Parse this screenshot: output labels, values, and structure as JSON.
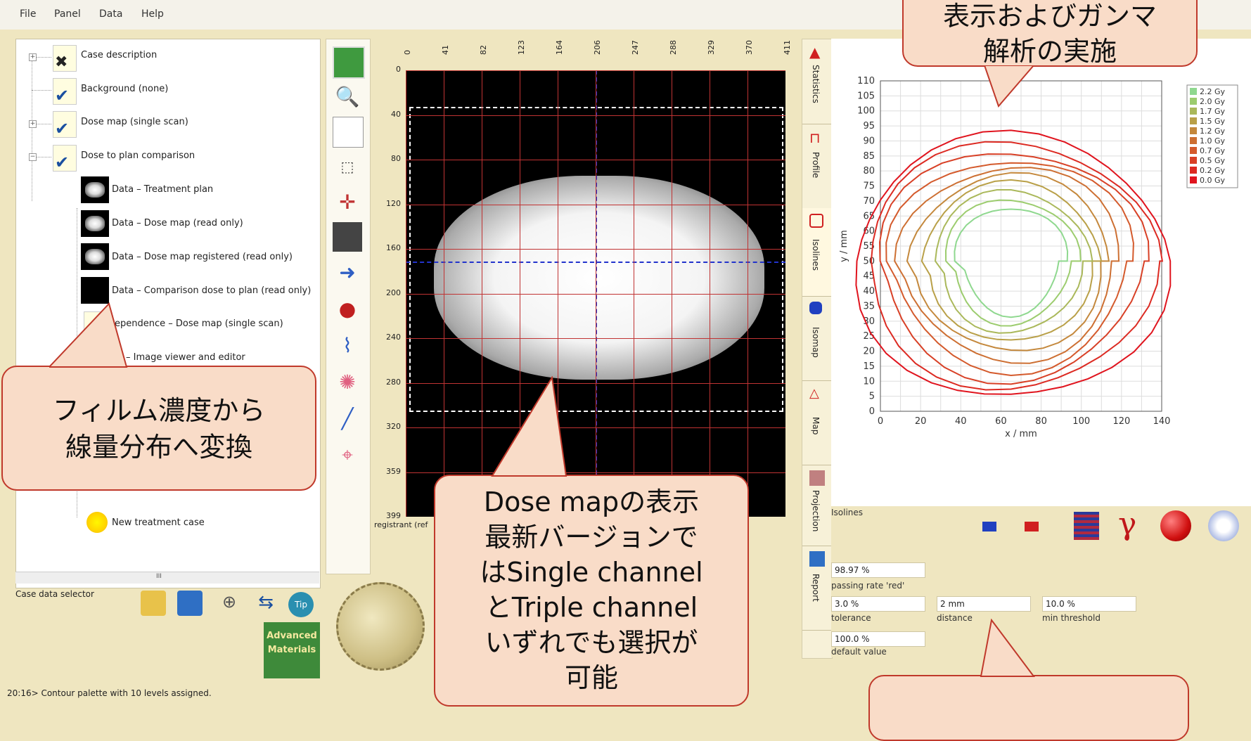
{
  "menu": [
    "File",
    "Panel",
    "Data",
    "Help"
  ],
  "tree": {
    "nodes": [
      {
        "label": "Case description"
      },
      {
        "label": "Background (none)"
      },
      {
        "label": "Dose map (single scan)"
      },
      {
        "label": "Dose to plan comparison"
      },
      {
        "label": "Data – Treatment plan"
      },
      {
        "label": "Data – Dose map (read only)"
      },
      {
        "label": "Data – Dose map registered (read only)"
      },
      {
        "label": "Data – Comparison dose to plan (read only)"
      },
      {
        "label": "ependence – Dose map (single scan)"
      },
      {
        "label": "– Image viewer and editor"
      },
      {
        "label": "New treatment case"
      }
    ],
    "selector_label": "Case data selector",
    "scroll_marker": "III"
  },
  "image": {
    "x_ticks": [
      "0",
      "41",
      "82",
      "123",
      "164",
      "206",
      "247",
      "288",
      "329",
      "370",
      "411"
    ],
    "y_ticks": [
      "0",
      "40",
      "80",
      "120",
      "160",
      "200",
      "240",
      "280",
      "320",
      "359",
      "399"
    ],
    "footer_label": "registrant (ref"
  },
  "vtabs": [
    "Statistics",
    "Profile",
    "Isolines",
    "Isomap",
    "Map",
    "Projection",
    "Report"
  ],
  "chart_data": {
    "type": "line",
    "xlabel": "x / mm",
    "ylabel": "y / mm",
    "xlim": [
      0,
      140
    ],
    "ylim": [
      0,
      110
    ],
    "x_ticks": [
      "0",
      "20",
      "40",
      "60",
      "80",
      "100",
      "120",
      "140"
    ],
    "y_ticks": [
      "110",
      "105",
      "100",
      "95",
      "90",
      "85",
      "80",
      "75",
      "70",
      "65",
      "60",
      "55",
      "50",
      "45",
      "40",
      "35",
      "30",
      "25",
      "20",
      "15",
      "10",
      "5",
      "0"
    ],
    "legend": [
      {
        "name": "2.2 Gy",
        "color": "#8fd88f"
      },
      {
        "name": "2.0 Gy",
        "color": "#9ccc6e"
      },
      {
        "name": "1.7 Gy",
        "color": "#aab85a"
      },
      {
        "name": "1.5 Gy",
        "color": "#b9a048"
      },
      {
        "name": "1.2 Gy",
        "color": "#c4883c"
      },
      {
        "name": "1.0 Gy",
        "color": "#cd6f32"
      },
      {
        "name": "0.7 Gy",
        "color": "#d45a2c"
      },
      {
        "name": "0.5 Gy",
        "color": "#d84026"
      },
      {
        "name": "0.2 Gy",
        "color": "#dc2a22"
      },
      {
        "name": "0.0 Gy",
        "color": "#e0141e"
      }
    ],
    "grid": true,
    "legend_position": "top-right"
  },
  "lower_panel": {
    "title": "Isolines",
    "passing_rate_value": "98.97 %",
    "passing_rate_label": "passing rate 'red'",
    "tolerance_value": "3.0 %",
    "tolerance_label": "tolerance",
    "distance_value": "2 mm",
    "distance_label": "distance",
    "threshold_value": "10.0 %",
    "threshold_label": "min threshold",
    "default_value": "100.0 %",
    "default_label": "default value"
  },
  "status": "20:16> Contour palette with 10 levels assigned.",
  "logo": "Advanced Materials",
  "callouts": {
    "film": "フィルム濃度から\n線量分布へ変換",
    "dose": "Dose mapの表示\n最新バージョンで\nはSingle channel\nとTriple channel\nいずれでも選択が\n可能",
    "gamma": "表示およびガンマ\n解析の実施"
  }
}
